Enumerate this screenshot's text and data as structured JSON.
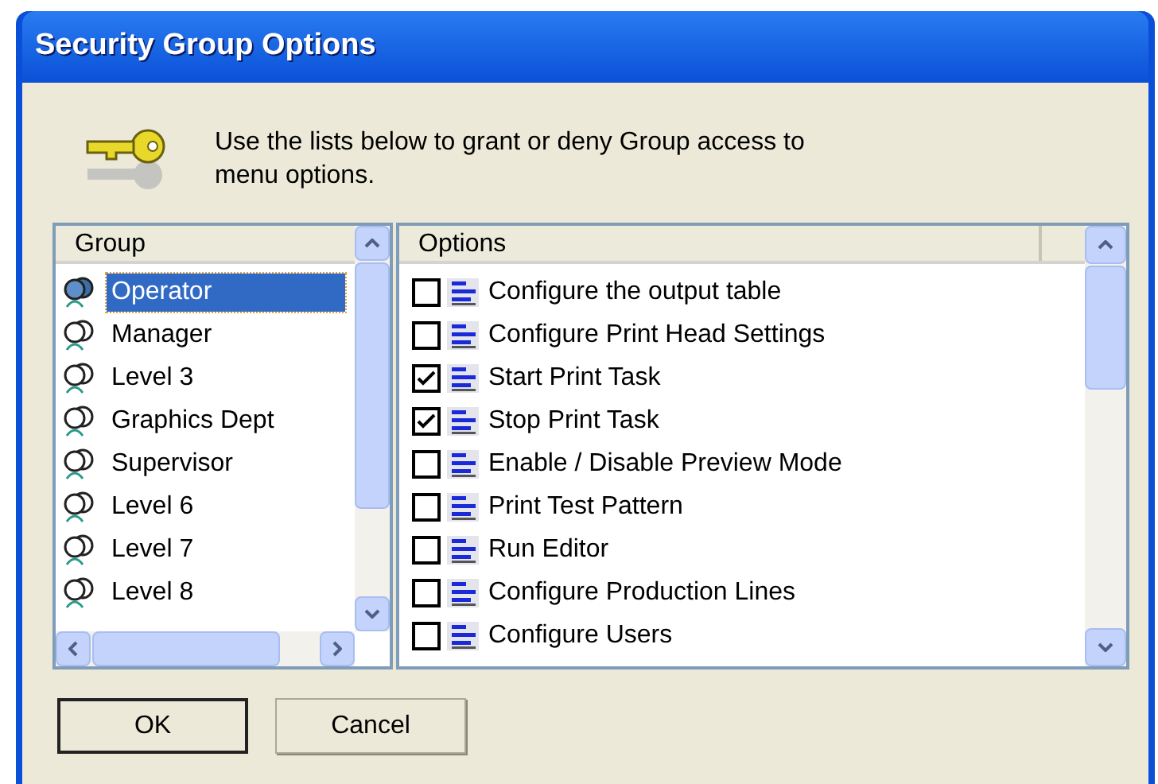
{
  "window": {
    "title": "Security Group Options"
  },
  "instructions": "Use the lists below to grant or deny Group access to menu options.",
  "groups": {
    "header": "Group",
    "items": [
      {
        "label": "Operator",
        "selected": true
      },
      {
        "label": "Manager",
        "selected": false
      },
      {
        "label": "Level 3",
        "selected": false
      },
      {
        "label": "Graphics Dept",
        "selected": false
      },
      {
        "label": "Supervisor",
        "selected": false
      },
      {
        "label": "Level 6",
        "selected": false
      },
      {
        "label": "Level 7",
        "selected": false
      },
      {
        "label": "Level 8",
        "selected": false
      }
    ]
  },
  "options": {
    "header": "Options",
    "items": [
      {
        "label": "Configure the output table",
        "checked": false
      },
      {
        "label": "Configure Print Head Settings",
        "checked": false
      },
      {
        "label": "Start Print Task",
        "checked": true
      },
      {
        "label": "Stop Print Task",
        "checked": true
      },
      {
        "label": "Enable / Disable Preview Mode",
        "checked": false
      },
      {
        "label": "Print Test Pattern",
        "checked": false
      },
      {
        "label": "Run Editor",
        "checked": false
      },
      {
        "label": "Configure Production Lines",
        "checked": false
      },
      {
        "label": "Configure Users",
        "checked": false
      }
    ]
  },
  "buttons": [
    {
      "label": "OK",
      "kind": "default"
    },
    {
      "label": "Cancel",
      "kind": "normal"
    }
  ]
}
